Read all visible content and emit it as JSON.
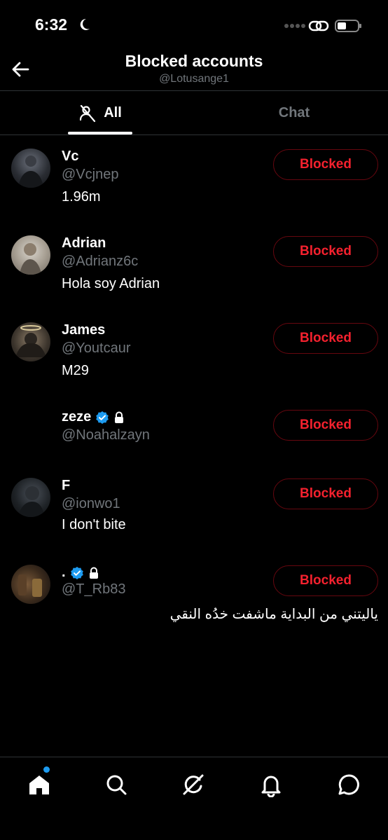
{
  "status_bar": {
    "time": "6:32"
  },
  "header": {
    "title": "Blocked accounts",
    "subtitle": "@Lotusange1"
  },
  "tabs": [
    {
      "label": "All"
    },
    {
      "label": "Chat"
    }
  ],
  "accounts": [
    {
      "name": "Vc",
      "handle": "@Vcjnep",
      "bio": "1.96m",
      "button": "Blocked"
    },
    {
      "name": "Adrian",
      "handle": "@Adrianz6c",
      "bio": "Hola soy Adrian",
      "button": "Blocked"
    },
    {
      "name": "James",
      "handle": "@Youtcaur",
      "bio": "M29",
      "button": "Blocked"
    },
    {
      "name": "zeze",
      "handle": "@Noahalzayn",
      "bio": "",
      "button": "Blocked",
      "verified": true,
      "protected": true
    },
    {
      "name": "F",
      "handle": "@ionwo1",
      "bio": "I don't bite",
      "button": "Blocked"
    },
    {
      "name": ".",
      "handle": "@T_Rb83",
      "bio": "ياليتني من البداية ماشفت خدُه النقي",
      "button": "Blocked",
      "verified": true,
      "protected": true
    }
  ],
  "colors": {
    "accent": "#1d9bf0",
    "blocked_red": "#f4212e",
    "muted": "#71767b"
  },
  "icons": [
    "back-arrow-icon",
    "blocked-person-icon",
    "home-icon",
    "search-icon",
    "grok-icon",
    "bell-icon",
    "messages-icon"
  ]
}
